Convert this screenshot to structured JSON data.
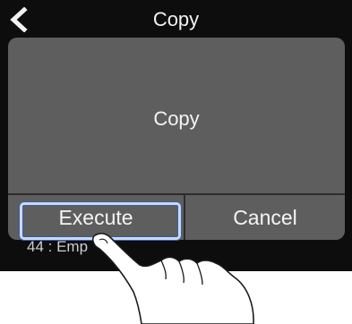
{
  "header": {
    "title": "Copy",
    "back_icon": "chevron-left-icon"
  },
  "background_list": {
    "partial_item": "44 : Emp"
  },
  "dialog": {
    "message": "Copy",
    "execute_label": "Execute",
    "cancel_label": "Cancel"
  },
  "gesture": {
    "icon": "hand-tap-icon",
    "target": "Execute"
  },
  "colors": {
    "screen_bg": "#0d0d0d",
    "dialog_bg": "#5e5e5e",
    "focus_ring": "#c9d9f2"
  }
}
